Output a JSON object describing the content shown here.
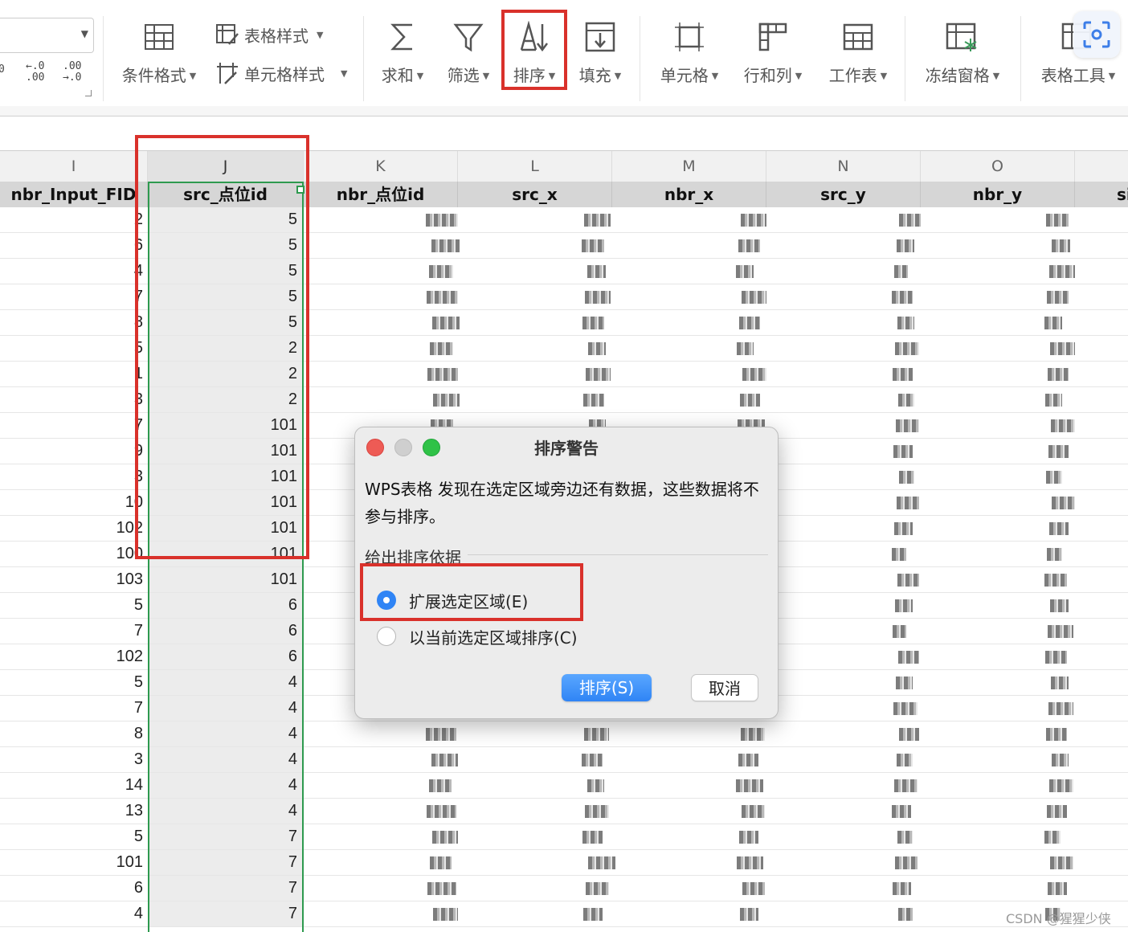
{
  "ribbon": {
    "number_format": {
      "btn1": "←.0\n.00",
      "btn2": ".00\n→.0",
      "partial": "0"
    },
    "cond_format_label": "条件格式",
    "table_style_label": "表格样式",
    "cell_style_label": "单元格样式",
    "sum_label": "求和",
    "filter_label": "筛选",
    "sort_label": "排序",
    "fill_label": "填充",
    "cell_label": "单元格",
    "rowcol_label": "行和列",
    "sheet_label": "工作表",
    "freeze_label": "冻结窗格",
    "tools_label": "表格工具",
    "icons": [
      "conditional-format-icon",
      "table-style-icon",
      "cell-style-icon",
      "sum-icon",
      "filter-icon",
      "sort-icon",
      "fill-icon",
      "cell-icon",
      "row-col-icon",
      "worksheet-icon",
      "freeze-pane-icon",
      "table-tools-icon",
      "screenshot-scan-icon"
    ]
  },
  "columns": {
    "letters": [
      "I",
      "J",
      "K",
      "L",
      "M",
      "N",
      "O"
    ],
    "fields": [
      "nbr_Input_FID",
      "src_点位id",
      "nbr_点位id",
      "src_x",
      "nbr_x",
      "src_y",
      "nbr_y",
      "si"
    ]
  },
  "rows": [
    {
      "i": "2",
      "j": "5"
    },
    {
      "i": "6",
      "j": "5"
    },
    {
      "i": "4",
      "j": "5"
    },
    {
      "i": "7",
      "j": "5"
    },
    {
      "i": "8",
      "j": "5"
    },
    {
      "i": "5",
      "j": "2"
    },
    {
      "i": "1",
      "j": "2"
    },
    {
      "i": "3",
      "j": "2"
    },
    {
      "i": "7",
      "j": "101"
    },
    {
      "i": "9",
      "j": "101"
    },
    {
      "i": "3",
      "j": "101"
    },
    {
      "i": "10",
      "j": "101"
    },
    {
      "i": "102",
      "j": "101"
    },
    {
      "i": "100",
      "j": "101"
    },
    {
      "i": "103",
      "j": "101"
    },
    {
      "i": "5",
      "j": "6"
    },
    {
      "i": "7",
      "j": "6"
    },
    {
      "i": "102",
      "j": "6"
    },
    {
      "i": "5",
      "j": "4"
    },
    {
      "i": "7",
      "j": "4"
    },
    {
      "i": "8",
      "j": "4"
    },
    {
      "i": "3",
      "j": "4"
    },
    {
      "i": "14",
      "j": "4"
    },
    {
      "i": "13",
      "j": "4"
    },
    {
      "i": "5",
      "j": "7"
    },
    {
      "i": "101",
      "j": "7"
    },
    {
      "i": "6",
      "j": "7"
    },
    {
      "i": "4",
      "j": "7"
    }
  ],
  "dialog": {
    "title": "排序警告",
    "message": "WPS表格 发现在选定区域旁边还有数据，这些数据将不参与排序。",
    "group_label": "给出排序依据",
    "option_expand": "扩展选定区域(E)",
    "option_current": "以当前选定区域排序(C)",
    "selected_option": "expand",
    "ok_label": "排序(S)",
    "cancel_label": "取消"
  },
  "colors": {
    "highlight": "#d9312b",
    "selection": "#2e9a4f",
    "accent": "#2f84f5"
  },
  "watermark": "CSDN @猩猩少侠"
}
